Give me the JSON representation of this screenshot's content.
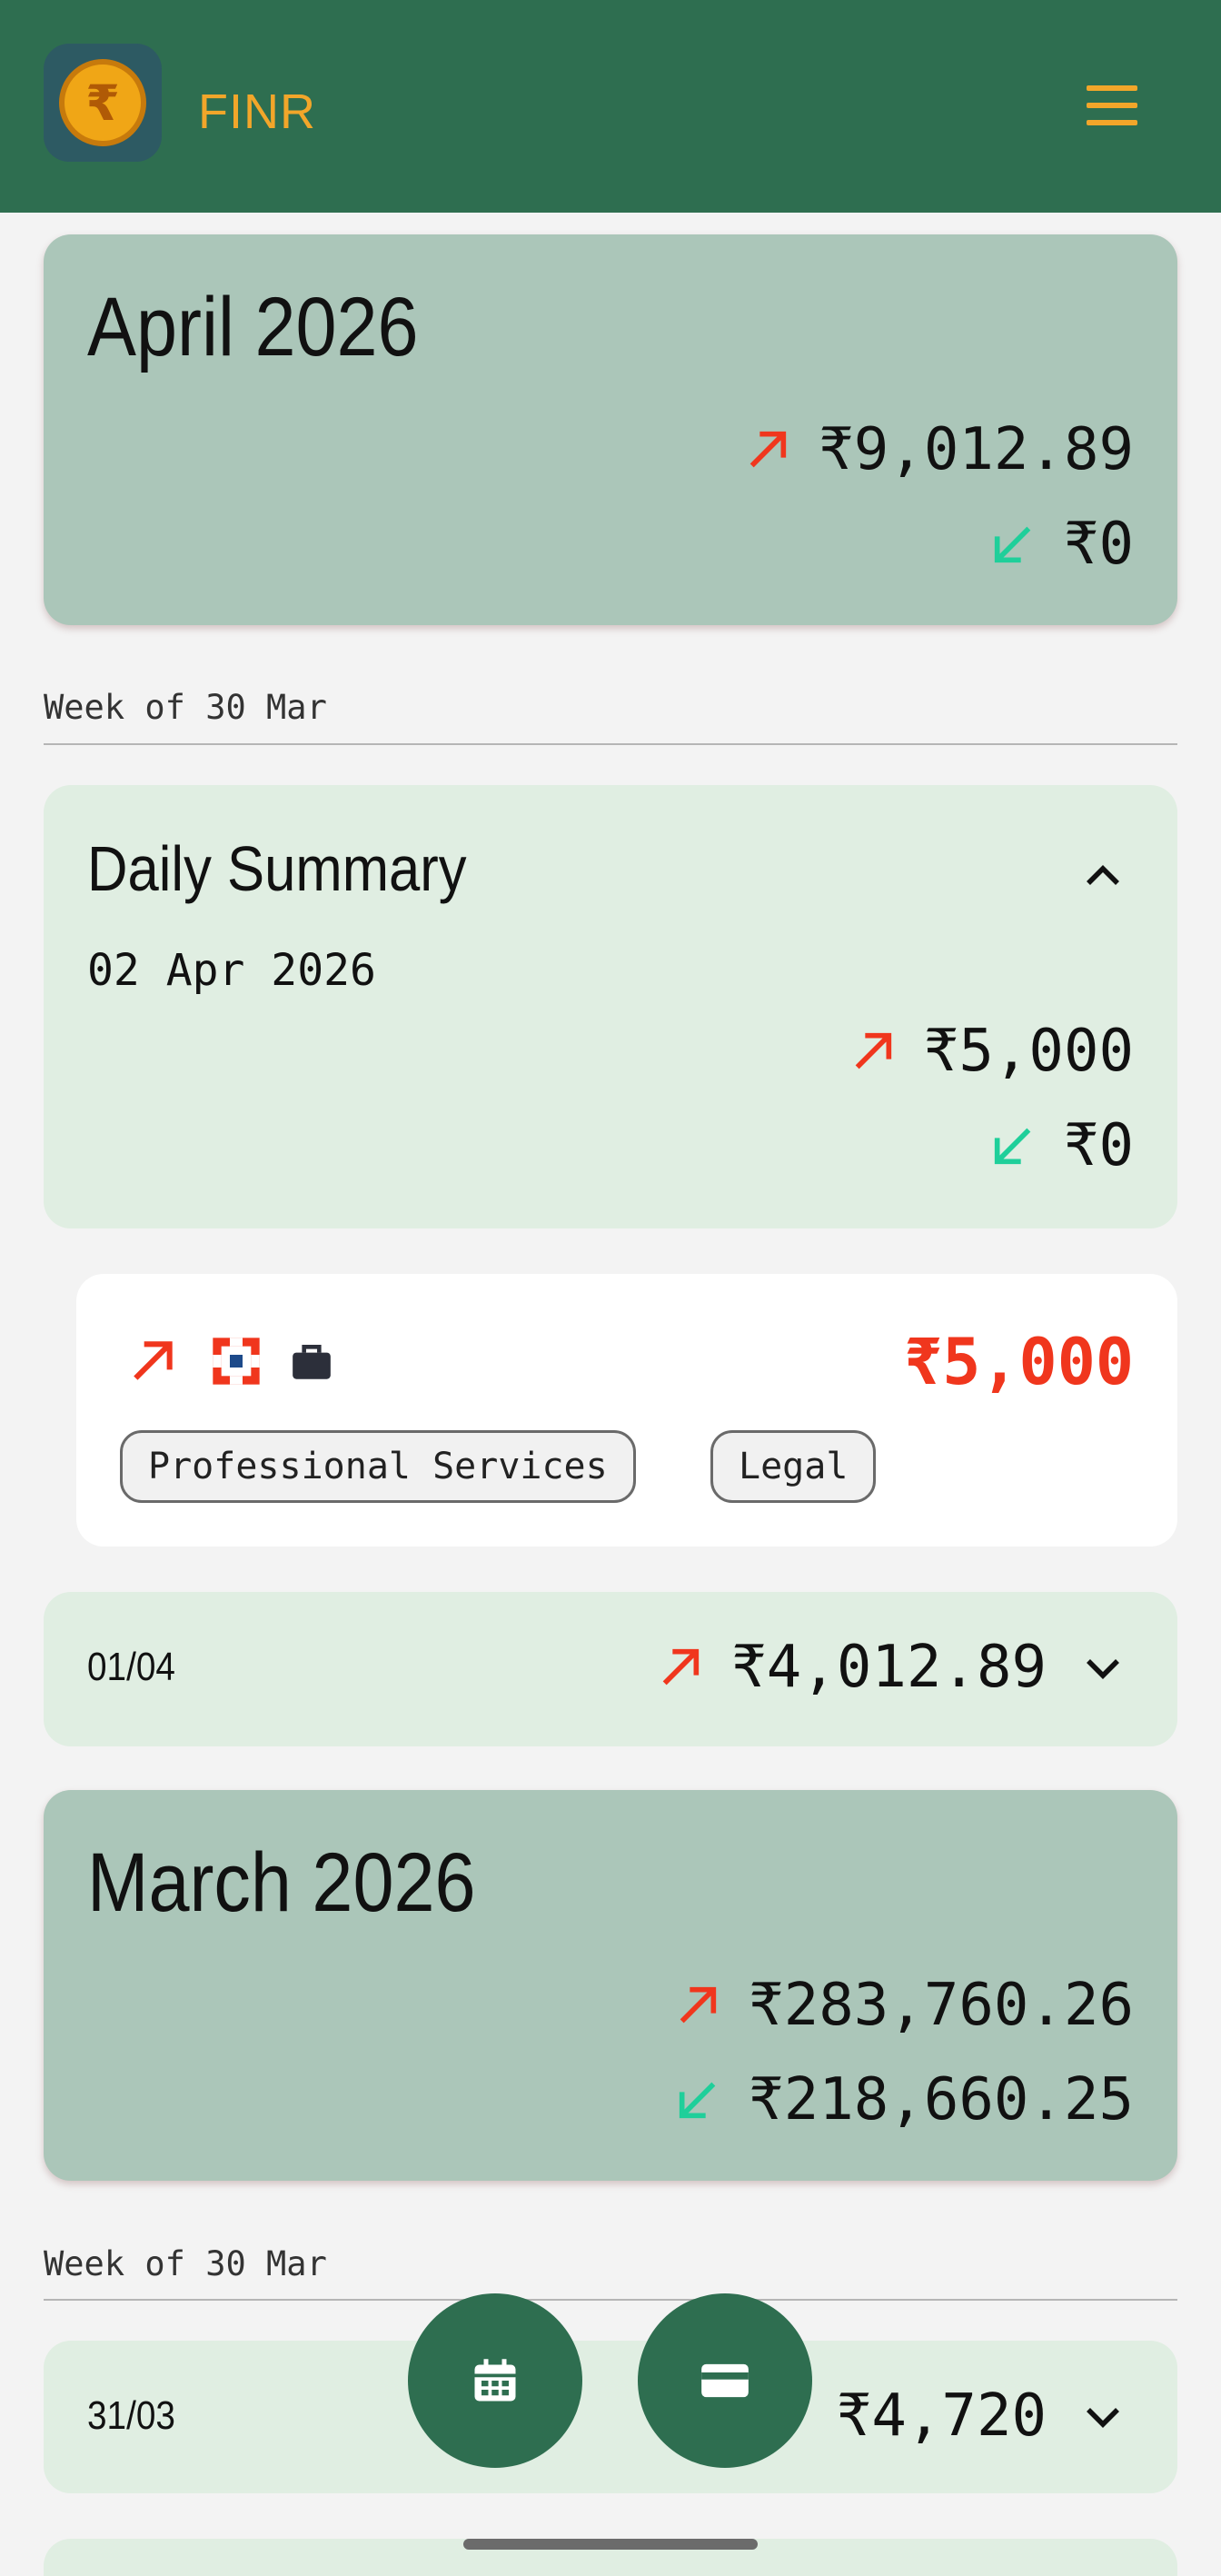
{
  "header": {
    "app_name": "FINR",
    "app_icon": "rupee-coin-icon",
    "menu_icon": "hamburger-menu-icon"
  },
  "colors": {
    "header": "#2e6e50",
    "accent": "#f2a62a",
    "expense": "#f0361d",
    "income": "#1fcf9a"
  },
  "april": {
    "title": "April 2026",
    "expense_total": "₹9,012.89",
    "income_total": "₹0",
    "week_label": "Week of 30 Mar",
    "daily_summary": {
      "title": "Daily Summary",
      "date": "02 Apr 2026",
      "expense": "₹5,000",
      "income": "₹0",
      "expanded": true
    },
    "transaction": {
      "amount": "₹5,000",
      "icons": [
        "expense-arrow-icon",
        "bank-logo-icon",
        "briefcase-icon"
      ],
      "tags": [
        "Professional Services",
        "Legal"
      ]
    },
    "collapsed_day": {
      "date": "01/04",
      "amount": "₹4,012.89"
    }
  },
  "march": {
    "title": "March 2026",
    "expense_total": "₹283,760.26",
    "income_total": "₹218,660.25",
    "week_label": "Week of 30 Mar",
    "collapsed_day": {
      "date": "31/03",
      "amount": "₹4,720"
    }
  },
  "fabs": {
    "calendar": "calendar-icon",
    "card": "credit-card-icon"
  }
}
